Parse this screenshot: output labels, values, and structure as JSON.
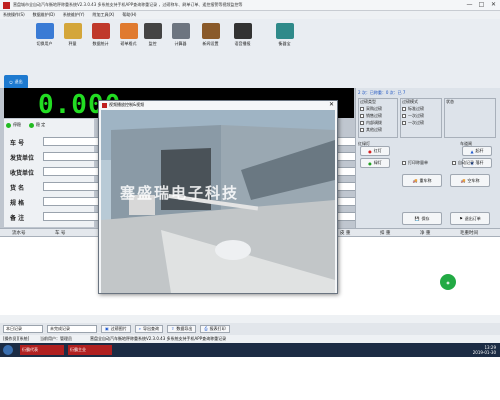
{
  "window": {
    "title": "营盘城市全自动汽车衡地秤称重系统V2.3.0.43 多系统支持手机APP查询称重记录 ，过磅称车、刷单订单、遥控报警等视频监控等",
    "controls": [
      "—",
      "□",
      "✕"
    ]
  },
  "menu": [
    "系统操作(S)",
    "数据维护(D)",
    "系统维护(Y)",
    "附加工具(X)",
    "帮助(H)"
  ],
  "toolbar": [
    {
      "label": "切换用户",
      "icon": "users-icon",
      "color": "#3a7bd5"
    },
    {
      "label": "秤量",
      "icon": "scale-icon",
      "color": "#d4a63a"
    },
    {
      "label": "数据统计",
      "icon": "chart-icon",
      "color": "#c0392b"
    },
    {
      "label": "磅单格式",
      "icon": "tag-icon",
      "color": "#e07a2f"
    },
    {
      "label": "监控",
      "icon": "camera-icon",
      "color": "#444444"
    },
    {
      "label": "计算器",
      "icon": "calculator-icon",
      "color": "#6d7580"
    },
    {
      "label": "新闻设置",
      "icon": "briefcase-icon",
      "color": "#8a5a2a"
    },
    {
      "label": "语音播报",
      "icon": "phone-icon",
      "color": "#333333"
    },
    {
      "label": "衡器宝",
      "icon": "device-icon",
      "color": "#2f8a8a"
    }
  ],
  "exit_label": "退出",
  "weight": {
    "value": "0.000"
  },
  "status": {
    "stable_label": "停稳",
    "steady_label": "稳 定"
  },
  "form": {
    "fields": [
      "车 号",
      "发货单位",
      "收货单位",
      "货 名",
      "规 格",
      "备 注"
    ]
  },
  "right_panel": {
    "counts": "2 次：已称重：0 次：已 7",
    "scale_type_title": "过磅类型",
    "scale_types": [
      "采购过磅",
      "销售过磅",
      "内部调拨",
      "其他过磅"
    ],
    "mode_title": "过磅模式",
    "modes": [
      "标准过磅",
      "一次过磅",
      "一次过磅"
    ],
    "status_title": "状态",
    "lights_title": "红绿灯",
    "gate_title": "车道闸",
    "light_buttons": [
      {
        "label": "红灯",
        "color": "#d62020"
      },
      {
        "label": "绿灯",
        "color": "#20a020"
      }
    ],
    "gate_buttons": [
      "起杆",
      "落杆"
    ],
    "print_checkbox": "打印称量单",
    "auto_record_checkbox": "自动记录",
    "action_buttons": [
      "重车称",
      "空车称",
      "保存",
      "退出订单"
    ]
  },
  "video": {
    "title": "视频播放控制&视频",
    "watermark": "塞盛瑞电子科技"
  },
  "grid": {
    "columns": [
      "流水号",
      "车 号",
      "发货单位",
      "收货单位",
      "货名",
      "毛 重",
      "皮 重",
      "扣 重",
      "净 重",
      "毛重时间"
    ]
  },
  "controls": {
    "filter_select": "本日记录",
    "status_select": "未完成记录",
    "buttons": [
      "过磅图片",
      "导出查询",
      "数据导出",
      "报表打印"
    ]
  },
  "statusbar": {
    "user": "[操作员][系统]",
    "role": "当前用户：管理员",
    "info": "营盘全自动汽车衡地秤称重系统V2.3.0.43 多系统支持手机APP查询称重记录"
  },
  "taskbar": {
    "apps": [
      "衍霸代表",
      "衍霸主业"
    ],
    "time": "13:29",
    "date": "2019-01-30"
  }
}
